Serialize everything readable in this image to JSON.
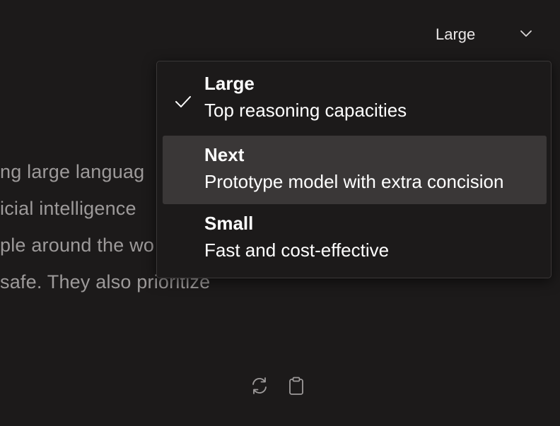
{
  "model_selector": {
    "selected_label": "Large",
    "icon": "chevron-down-icon"
  },
  "response": {
    "lines": [
      "ng large languag",
      "icial intelligence",
      "ple around the wo",
      "safe. They also prioritize"
    ]
  },
  "actions": {
    "regenerate_icon": "refresh-icon",
    "copy_icon": "clipboard-icon"
  },
  "dropdown": {
    "options": [
      {
        "title": "Large",
        "description": "Top reasoning capacities",
        "selected": true
      },
      {
        "title": "Next",
        "description": "Prototype model with extra concision",
        "selected": false
      },
      {
        "title": "Small",
        "description": "Fast and cost-effective",
        "selected": false
      }
    ]
  },
  "colors": {
    "background": "#1c1a1a",
    "highlight": "#3a3737",
    "muted_text": "#9d9a9a"
  }
}
